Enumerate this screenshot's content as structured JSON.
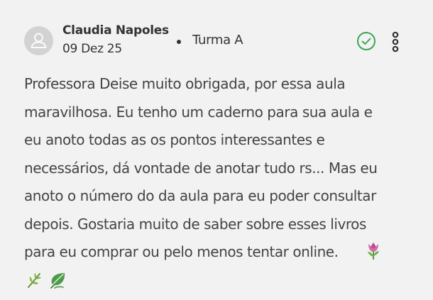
{
  "post": {
    "author": "Claudia Napoles",
    "date": "09 Dez 25",
    "class_name": "Turma A",
    "body": "Professora Deise muito obrigada, por essa aula\nmaravilhosa. Eu tenho um caderno para sua aula e\neu anoto todas as os pontos interessantes e\nnecessários, dá vontade de anotar tudo rs... Mas eu\nanoto o número do da aula para eu poder consultar\ndepois. Gostaria muito de saber sobre esses livros\npara eu comprar ou pelo menos tentar online.",
    "emojis": [
      "tulip-emoji",
      "herb-emoji",
      "leaf-emoji"
    ]
  },
  "icons": {
    "avatar": "user-icon",
    "approve": "check-circle-icon",
    "menu": "more-vertical-icon"
  },
  "colors": {
    "background": "#f2f2f2",
    "text": "#333333",
    "approve_green": "#3aa655",
    "avatar_bg": "#d2d2d2"
  }
}
